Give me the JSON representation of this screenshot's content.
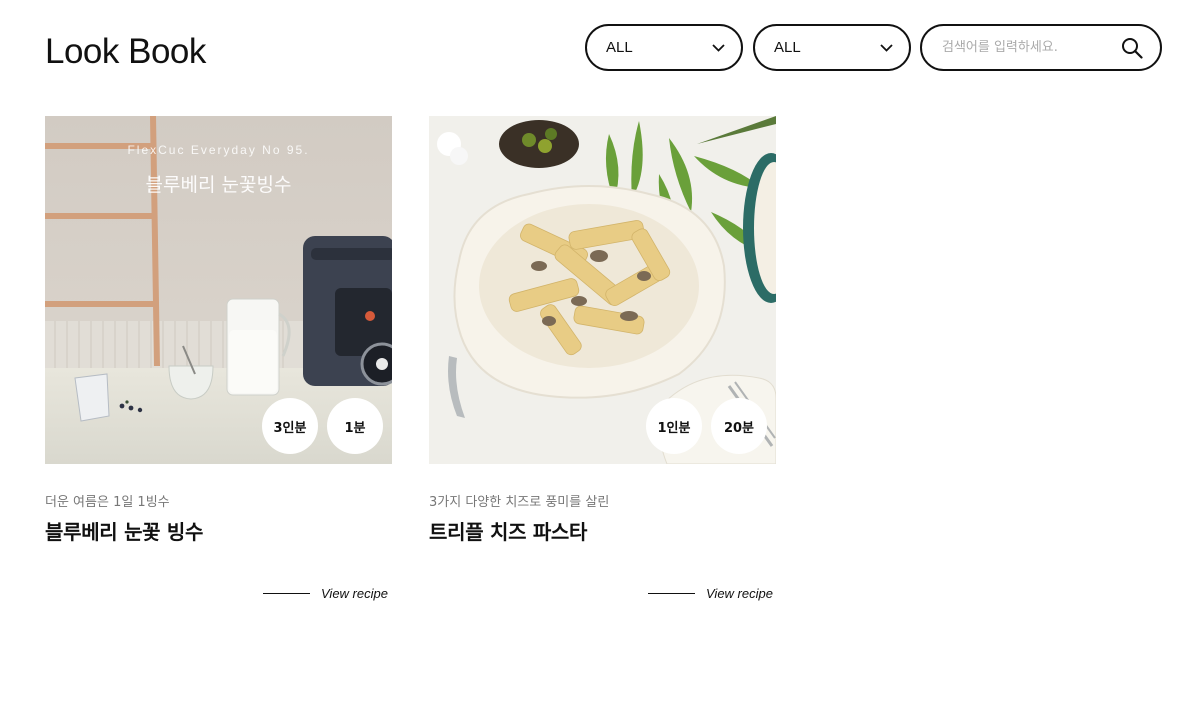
{
  "header": {
    "title": "Look Book",
    "filter_1": {
      "value": "ALL"
    },
    "filter_2": {
      "value": "ALL"
    },
    "search": {
      "placeholder": "검색어를 입력하세요.",
      "value": ""
    }
  },
  "cards": [
    {
      "image_caption_en": "FlexCuc Everyday No 95.",
      "image_caption_ko": "블루베리 눈꽃빙수",
      "badges": [
        "3인분",
        "1분"
      ],
      "subtitle": "더운 여름은 1일 1빙수",
      "title": "블루베리 눈꽃 빙수",
      "link_label": "View recipe"
    },
    {
      "badges": [
        "1인분",
        "20분"
      ],
      "subtitle": "3가지 다양한 치즈로 풍미를 살린",
      "title": "트리플 치즈 파스타",
      "link_label": "View recipe"
    }
  ]
}
